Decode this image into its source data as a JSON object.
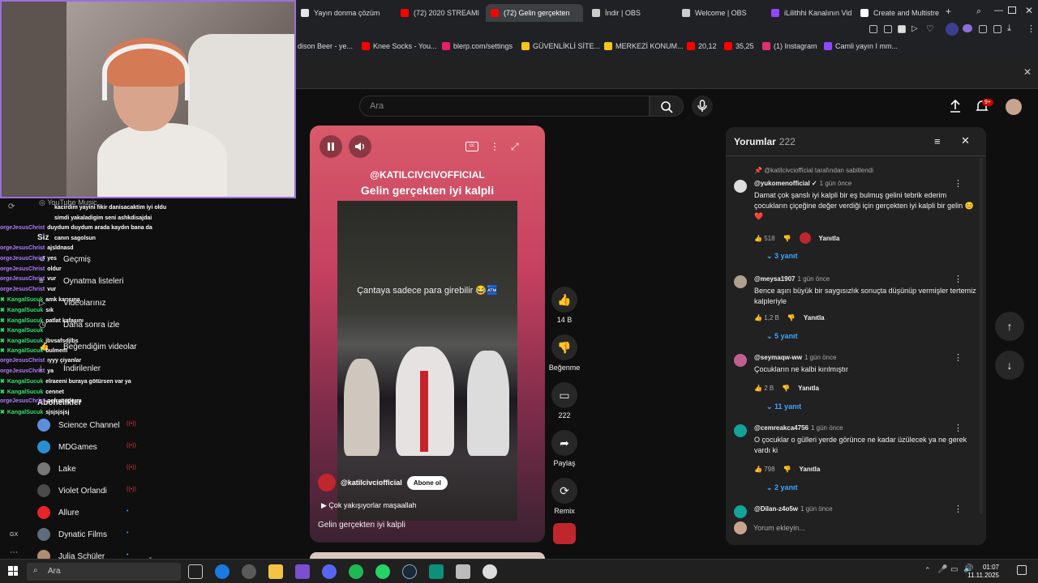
{
  "browser": {
    "tabs": [
      {
        "label": "Yayın donma çözüm",
        "color": "#e5e5e5"
      },
      {
        "label": "(72) 2020 STREAMI",
        "color": "#ff0000"
      },
      {
        "label": "(72) Gelin gerçekten",
        "color": "#ff0000"
      },
      {
        "label": "İndir | OBS",
        "color": "#cccccc"
      },
      {
        "label": "Welcome | OBS",
        "color": "#cccccc"
      },
      {
        "label": "iLilithhi Kanalının Vid",
        "color": "#9146ff"
      },
      {
        "label": "Create and Multistre",
        "color": "#ffffff"
      }
    ],
    "bookmarks": [
      {
        "label": "dison Beer - ye...",
        "color": "#888888"
      },
      {
        "label": "Knee Socks - You...",
        "color": "#ff0000"
      },
      {
        "label": "blerp.com/settings",
        "color": "#e91e63"
      },
      {
        "label": "GÜVENLİKLİ SİTE...",
        "color": "#f5c518"
      },
      {
        "label": "MERKEZİ KONUM...",
        "color": "#f5c518"
      },
      {
        "label": "20,12",
        "color": "#ff0000"
      },
      {
        "label": "35,25",
        "color": "#ff0000"
      },
      {
        "label": "(1) Instagram",
        "color": "#e1306c"
      },
      {
        "label": "Camli yayın I mm...",
        "color": "#9146ff"
      }
    ]
  },
  "youtube": {
    "search_placeholder": "Ara",
    "notification_count": "9+",
    "short": {
      "handle_overlay": "@KATILCIVCIVOFFICIAL",
      "title_overlay": "Gelin gerçekten iyi kalpli",
      "video_caption": "Çantaya sadece para girebilir 😂🏧",
      "channel": "@katilcivciofficial",
      "subscribe_label": "Abone ol",
      "song": "Çok yakışıyorlar maşaallah",
      "title": "Gelin gerçekten iyi kalpli"
    },
    "actions": {
      "like_count": "14 B",
      "dislike_label": "Beğenme",
      "comment_count": "222",
      "share_label": "Paylaş",
      "remix_label": "Remix"
    },
    "comments": {
      "title": "Yorumlar",
      "count": "222",
      "pinned": "@katilcivciofficial tarafından sabitlendi",
      "reply_label": "Yanıtla",
      "add_placeholder": "Yorum ekleyin...",
      "items": [
        {
          "user": "@yukomenofficial ✓",
          "time": "1 gün önce",
          "text": "Damat çok şanslı iyi kalpli bir eş bulmuş gelini tebrik ederim çocukların çiçeğine değer verdiği için gerçekten iyi kalpli bir gelin 😊❤️",
          "likes": "518",
          "replies": "3 yanıt",
          "color": "#dddddd"
        },
        {
          "user": "@meysa1907",
          "time": "1 gün önce",
          "text": "Bence aşırı büyük bir saygısızlık sonuçta düşünüp vermişler tertemiz kalpleriyle",
          "likes": "1,2 B",
          "replies": "5 yanıt",
          "color": "#b0a090"
        },
        {
          "user": "@seymaqw-ww",
          "time": "1 gün önce",
          "text": "Çocukların ne kalbi kırılmıştır",
          "likes": "2 B",
          "replies": "11 yanıt",
          "color": "#c06090"
        },
        {
          "user": "@cemreakca4756",
          "time": "1 gün önce",
          "text": "O çocuklar o gülleri yerde görünce ne kadar üzülecek ya ne gerek vardı ki",
          "likes": "798",
          "replies": "2 yanıt",
          "color": "#12a39a"
        },
        {
          "user": "@Dilan-z4o5w",
          "time": "1 gün önce",
          "text": "",
          "likes": "",
          "replies": "",
          "color": "#12a39a"
        }
      ]
    },
    "sidebar": {
      "music": "YouTube Music",
      "you_label": "Siz",
      "nav": [
        "Geçmiş",
        "Oynatma listeleri",
        "Videolarınız",
        "Daha sonra izle",
        "Beğendiğim videolar",
        "İndirilenler"
      ],
      "subs_label": "Abonelikler",
      "subs": [
        {
          "name": "Science Channel",
          "color": "#5b8fd9",
          "live": true
        },
        {
          "name": "MDGames",
          "color": "#2a8fd0",
          "live": true
        },
        {
          "name": "Lake",
          "color": "#777777",
          "live": true
        },
        {
          "name": "Violet Orlandi",
          "color": "#4a4a4a",
          "live": true
        },
        {
          "name": "Allure",
          "color": "#e8232a",
          "live": false
        },
        {
          "name": "Dynatic Films",
          "color": "#5d6b7a",
          "live": false
        },
        {
          "name": "Julia Schüler",
          "color": "#b08a70",
          "live": false
        }
      ]
    }
  },
  "chat": [
    {
      "user": "",
      "msg": "kacirdim yayini fikir danisacaktim iyi oldu",
      "u": 1
    },
    {
      "user": "",
      "msg": "simdi yakaladigim seni ashkdisajdai",
      "u": 1
    },
    {
      "user": "orgeJesusChrist",
      "msg": "duydum duydum arada kaydın bana da",
      "u": 1
    },
    {
      "user": "",
      "msg": "canın sagolsun",
      "u": 1
    },
    {
      "user": "orgeJesusChrist",
      "msg": "ajsldnasd",
      "u": 1
    },
    {
      "user": "orgeJesusChrist",
      "msg": "yes",
      "u": 1
    },
    {
      "user": "orgeJesusChrist",
      "msg": "oldur",
      "u": 1
    },
    {
      "user": "orgeJesusChrist",
      "msg": "vur",
      "u": 1
    },
    {
      "user": "orgeJesusChrist",
      "msg": "vur",
      "u": 1
    },
    {
      "user": "KangalSucuk",
      "msg": "amk karısına",
      "u": 2
    },
    {
      "user": "KangalSucuk",
      "msg": "sık",
      "u": 2
    },
    {
      "user": "KangalSucuk",
      "msg": "patlat kafasını",
      "u": 2
    },
    {
      "user": "KangalSucuk",
      "msg": "",
      "u": 2
    },
    {
      "user": "KangalSucuk",
      "msg": "jbvsafsdjlbs",
      "u": 2
    },
    {
      "user": "KangalSucuk",
      "msg": "bulmem",
      "u": 2
    },
    {
      "user": "orgeJesusChrist",
      "msg": "ıyyy çiyanlar",
      "u": 1
    },
    {
      "user": "orgeJesusChrist",
      "msg": "ya",
      "u": 1
    },
    {
      "user": "KangalSucuk",
      "msg": "elraeeni buraya götürsen var ya",
      "u": 2
    },
    {
      "user": "KangalSucuk",
      "msg": "cennet",
      "u": 2
    },
    {
      "user": "orgeJesusChrist",
      "msg": "nefret ederm",
      "u": 1
    },
    {
      "user": "KangalSucuk",
      "msg": "sjsjsjsjsj",
      "u": 2
    }
  ],
  "taskbar": {
    "search": "Ara",
    "time": "01:07",
    "date": "11.11.2025"
  }
}
